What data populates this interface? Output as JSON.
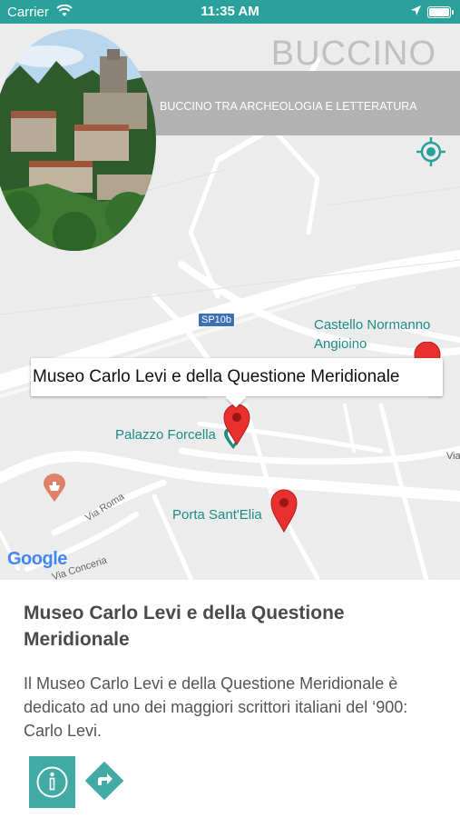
{
  "status_bar": {
    "carrier": "Carrier",
    "time": "11:35 AM"
  },
  "header": {
    "title": "BUCCINO",
    "subtitle": "BUCCINO TRA ARCHEOLOGIA E LETTERATURA"
  },
  "map": {
    "callout": "Museo Carlo Levi e della Questione Meridionale",
    "labels": {
      "castello": "Castello Normanno Angioino",
      "palazzo": "Palazzo Forcella",
      "porta": "Porta Sant'Elia",
      "sp10b": "SP10b",
      "via_roma": "Via Roma",
      "via_conceria": "Via Conceria",
      "via_edge": "Via"
    },
    "attribution": "Google"
  },
  "detail": {
    "title": "Museo Carlo Levi e della Questione Meridionale",
    "description": "Il Museo Carlo Levi e della Questione Meridionale è dedicato ad uno dei maggiori scrittori italiani del ‘900: Carlo Levi."
  },
  "colors": {
    "accent": "#2aa19a",
    "pin": "#e8312f",
    "poi_text": "#1d8c86"
  },
  "icons": [
    "wifi-icon",
    "location-arrow-icon",
    "battery-icon",
    "locate-me-icon",
    "map-pin-icon",
    "museum-icon",
    "info-icon",
    "directions-icon"
  ]
}
